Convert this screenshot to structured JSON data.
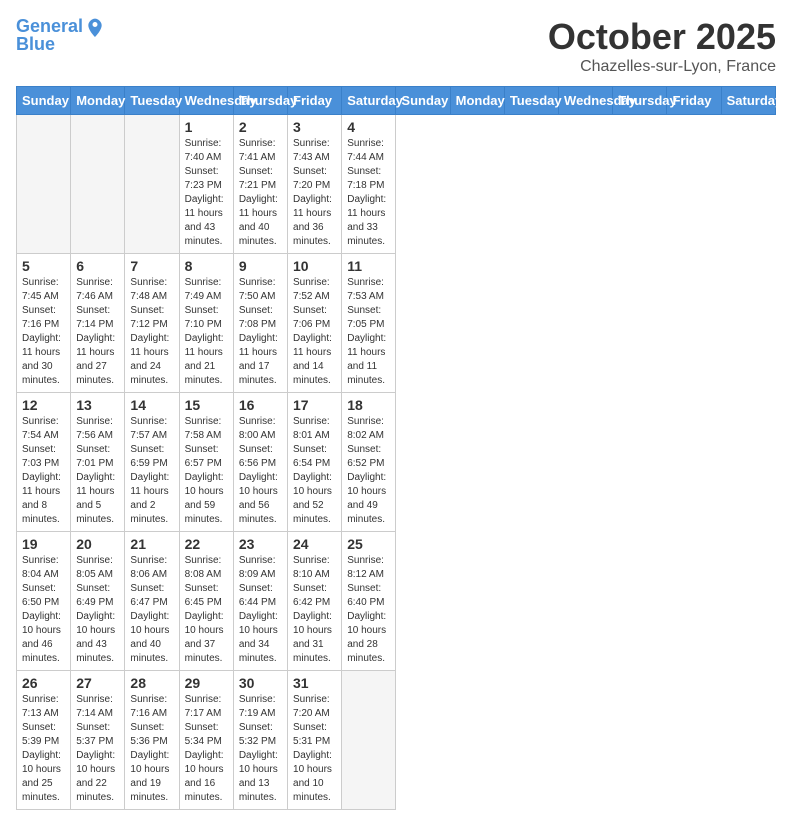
{
  "header": {
    "logo_line1": "General",
    "logo_line2": "Blue",
    "month": "October 2025",
    "location": "Chazelles-sur-Lyon, France"
  },
  "days_of_week": [
    "Sunday",
    "Monday",
    "Tuesday",
    "Wednesday",
    "Thursday",
    "Friday",
    "Saturday"
  ],
  "weeks": [
    [
      {
        "day": "",
        "info": ""
      },
      {
        "day": "",
        "info": ""
      },
      {
        "day": "",
        "info": ""
      },
      {
        "day": "1",
        "info": "Sunrise: 7:40 AM\nSunset: 7:23 PM\nDaylight: 11 hours\nand 43 minutes."
      },
      {
        "day": "2",
        "info": "Sunrise: 7:41 AM\nSunset: 7:21 PM\nDaylight: 11 hours\nand 40 minutes."
      },
      {
        "day": "3",
        "info": "Sunrise: 7:43 AM\nSunset: 7:20 PM\nDaylight: 11 hours\nand 36 minutes."
      },
      {
        "day": "4",
        "info": "Sunrise: 7:44 AM\nSunset: 7:18 PM\nDaylight: 11 hours\nand 33 minutes."
      }
    ],
    [
      {
        "day": "5",
        "info": "Sunrise: 7:45 AM\nSunset: 7:16 PM\nDaylight: 11 hours\nand 30 minutes."
      },
      {
        "day": "6",
        "info": "Sunrise: 7:46 AM\nSunset: 7:14 PM\nDaylight: 11 hours\nand 27 minutes."
      },
      {
        "day": "7",
        "info": "Sunrise: 7:48 AM\nSunset: 7:12 PM\nDaylight: 11 hours\nand 24 minutes."
      },
      {
        "day": "8",
        "info": "Sunrise: 7:49 AM\nSunset: 7:10 PM\nDaylight: 11 hours\nand 21 minutes."
      },
      {
        "day": "9",
        "info": "Sunrise: 7:50 AM\nSunset: 7:08 PM\nDaylight: 11 hours\nand 17 minutes."
      },
      {
        "day": "10",
        "info": "Sunrise: 7:52 AM\nSunset: 7:06 PM\nDaylight: 11 hours\nand 14 minutes."
      },
      {
        "day": "11",
        "info": "Sunrise: 7:53 AM\nSunset: 7:05 PM\nDaylight: 11 hours\nand 11 minutes."
      }
    ],
    [
      {
        "day": "12",
        "info": "Sunrise: 7:54 AM\nSunset: 7:03 PM\nDaylight: 11 hours\nand 8 minutes."
      },
      {
        "day": "13",
        "info": "Sunrise: 7:56 AM\nSunset: 7:01 PM\nDaylight: 11 hours\nand 5 minutes."
      },
      {
        "day": "14",
        "info": "Sunrise: 7:57 AM\nSunset: 6:59 PM\nDaylight: 11 hours\nand 2 minutes."
      },
      {
        "day": "15",
        "info": "Sunrise: 7:58 AM\nSunset: 6:57 PM\nDaylight: 10 hours\nand 59 minutes."
      },
      {
        "day": "16",
        "info": "Sunrise: 8:00 AM\nSunset: 6:56 PM\nDaylight: 10 hours\nand 56 minutes."
      },
      {
        "day": "17",
        "info": "Sunrise: 8:01 AM\nSunset: 6:54 PM\nDaylight: 10 hours\nand 52 minutes."
      },
      {
        "day": "18",
        "info": "Sunrise: 8:02 AM\nSunset: 6:52 PM\nDaylight: 10 hours\nand 49 minutes."
      }
    ],
    [
      {
        "day": "19",
        "info": "Sunrise: 8:04 AM\nSunset: 6:50 PM\nDaylight: 10 hours\nand 46 minutes."
      },
      {
        "day": "20",
        "info": "Sunrise: 8:05 AM\nSunset: 6:49 PM\nDaylight: 10 hours\nand 43 minutes."
      },
      {
        "day": "21",
        "info": "Sunrise: 8:06 AM\nSunset: 6:47 PM\nDaylight: 10 hours\nand 40 minutes."
      },
      {
        "day": "22",
        "info": "Sunrise: 8:08 AM\nSunset: 6:45 PM\nDaylight: 10 hours\nand 37 minutes."
      },
      {
        "day": "23",
        "info": "Sunrise: 8:09 AM\nSunset: 6:44 PM\nDaylight: 10 hours\nand 34 minutes."
      },
      {
        "day": "24",
        "info": "Sunrise: 8:10 AM\nSunset: 6:42 PM\nDaylight: 10 hours\nand 31 minutes."
      },
      {
        "day": "25",
        "info": "Sunrise: 8:12 AM\nSunset: 6:40 PM\nDaylight: 10 hours\nand 28 minutes."
      }
    ],
    [
      {
        "day": "26",
        "info": "Sunrise: 7:13 AM\nSunset: 5:39 PM\nDaylight: 10 hours\nand 25 minutes."
      },
      {
        "day": "27",
        "info": "Sunrise: 7:14 AM\nSunset: 5:37 PM\nDaylight: 10 hours\nand 22 minutes."
      },
      {
        "day": "28",
        "info": "Sunrise: 7:16 AM\nSunset: 5:36 PM\nDaylight: 10 hours\nand 19 minutes."
      },
      {
        "day": "29",
        "info": "Sunrise: 7:17 AM\nSunset: 5:34 PM\nDaylight: 10 hours\nand 16 minutes."
      },
      {
        "day": "30",
        "info": "Sunrise: 7:19 AM\nSunset: 5:32 PM\nDaylight: 10 hours\nand 13 minutes."
      },
      {
        "day": "31",
        "info": "Sunrise: 7:20 AM\nSunset: 5:31 PM\nDaylight: 10 hours\nand 10 minutes."
      },
      {
        "day": "",
        "info": ""
      }
    ]
  ]
}
